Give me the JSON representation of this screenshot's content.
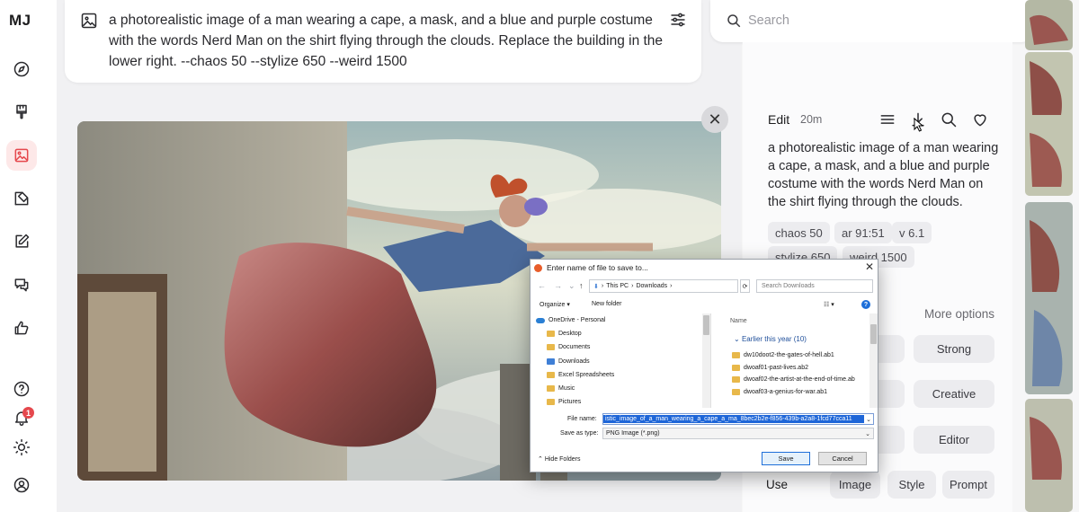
{
  "app": {
    "logo": "MJ"
  },
  "rail": {
    "items": [
      {
        "name": "explore",
        "icon": "compass-icon"
      },
      {
        "name": "create",
        "icon": "brush-icon"
      },
      {
        "name": "organize",
        "icon": "image-icon",
        "active": true
      },
      {
        "name": "edit",
        "icon": "edit-image-icon"
      },
      {
        "name": "personalize",
        "icon": "pencil-square-icon"
      },
      {
        "name": "chat",
        "icon": "chat-bubbles-icon"
      },
      {
        "name": "tasks",
        "icon": "thumbs-up-icon"
      },
      {
        "name": "help",
        "icon": "help-circle-icon"
      },
      {
        "name": "updates",
        "icon": "bell-icon"
      },
      {
        "name": "light-mode",
        "icon": "sun-icon"
      },
      {
        "name": "account",
        "icon": "user-circle-icon"
      }
    ],
    "notification_count": "1"
  },
  "prompt_bar": {
    "text": "a photorealistic image of a man wearing a cape, a mask, and a blue and purple costume with the words Nerd Man on the shirt flying through the clouds. Replace the building in the lower right. --chaos 50 --stylize 650 --weird 1500"
  },
  "close_label": "✕",
  "search": {
    "placeholder": "Search"
  },
  "details": {
    "edit_label": "Edit",
    "time": "20m",
    "description": "a photorealistic image of a man wearing a cape, a mask, and a blue and purple costume with the words Nerd Man on the shirt flying through the clouds.",
    "chips": [
      "chaos 50",
      "ar 91:51",
      "v 6.1",
      "stylize 650",
      "weird 1500"
    ],
    "more_options": "More options",
    "option_buttons": [
      "e",
      "Strong",
      "e",
      "Creative",
      "n",
      "Editor"
    ],
    "use_label": "Use",
    "use_buttons": [
      "Image",
      "Style",
      "Prompt"
    ]
  },
  "dialog": {
    "title": "Enter name of file to save to...",
    "address": [
      "This PC",
      "Downloads"
    ],
    "search_placeholder": "Search Downloads",
    "organize": "Organize ▾",
    "new_folder": "New folder",
    "tree": [
      {
        "label": "OneDrive - Personal",
        "icon": "cloud-icon"
      },
      {
        "label": "Desktop",
        "icon": "folder-icon"
      },
      {
        "label": "Documents",
        "icon": "folder-icon"
      },
      {
        "label": "Downloads",
        "icon": "download-folder-icon"
      },
      {
        "label": "Excel Spreadsheets",
        "icon": "folder-icon"
      },
      {
        "label": "Music",
        "icon": "folder-icon"
      },
      {
        "label": "Pictures",
        "icon": "folder-icon"
      }
    ],
    "name_header": "Name",
    "group": "Earlier this year (10)",
    "files": [
      "dw10doot2-the-gates-of-hell.ab1",
      "dwoaf01-past-lives.ab2",
      "dwoaf02-the-artist-at-the-end-of-time.ab",
      "dwoaf03-a-genius-for-war.ab1"
    ],
    "file_name_label": "File name:",
    "file_name": "istic_image_of_a_man_wearing_a_cape_a_ma_8bec2b2e-f856-439b-a2a8-1fcd77cca11",
    "save_as_label": "Save as type:",
    "save_as": "PNG Image (*.png)",
    "hide_folders": "Hide Folders",
    "save": "Save",
    "cancel": "Cancel"
  }
}
